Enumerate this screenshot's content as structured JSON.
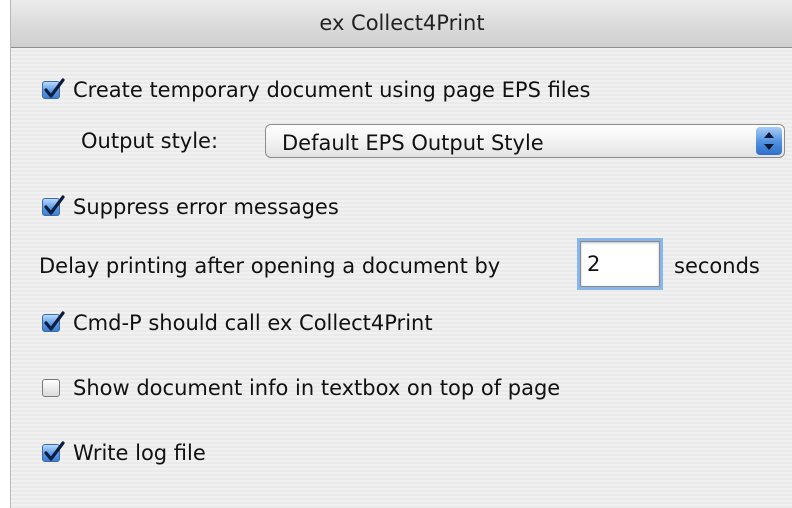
{
  "window": {
    "title": "ex Collect4Print"
  },
  "options": {
    "create_temp_doc": {
      "label": "Create temporary document using page EPS files",
      "checked": true
    },
    "output_style": {
      "label": "Output style:",
      "value": "Default EPS Output Style"
    },
    "suppress_errors": {
      "label": "Suppress error messages",
      "checked": true
    },
    "delay": {
      "label": "Delay printing after opening a document by",
      "value": "2",
      "unit": "seconds"
    },
    "cmd_p": {
      "label": "Cmd-P should call ex Collect4Print",
      "checked": true
    },
    "show_doc_info": {
      "label": "Show document info in textbox on top of page",
      "checked": false
    },
    "write_log": {
      "label": "Write log file",
      "checked": true
    }
  },
  "icons": {
    "checkmark": "checkmark-icon",
    "popup_arrows": "updown-arrows-icon"
  },
  "colors": {
    "accent": "#4f8fe0",
    "focus_ring": "#86b6ea"
  }
}
